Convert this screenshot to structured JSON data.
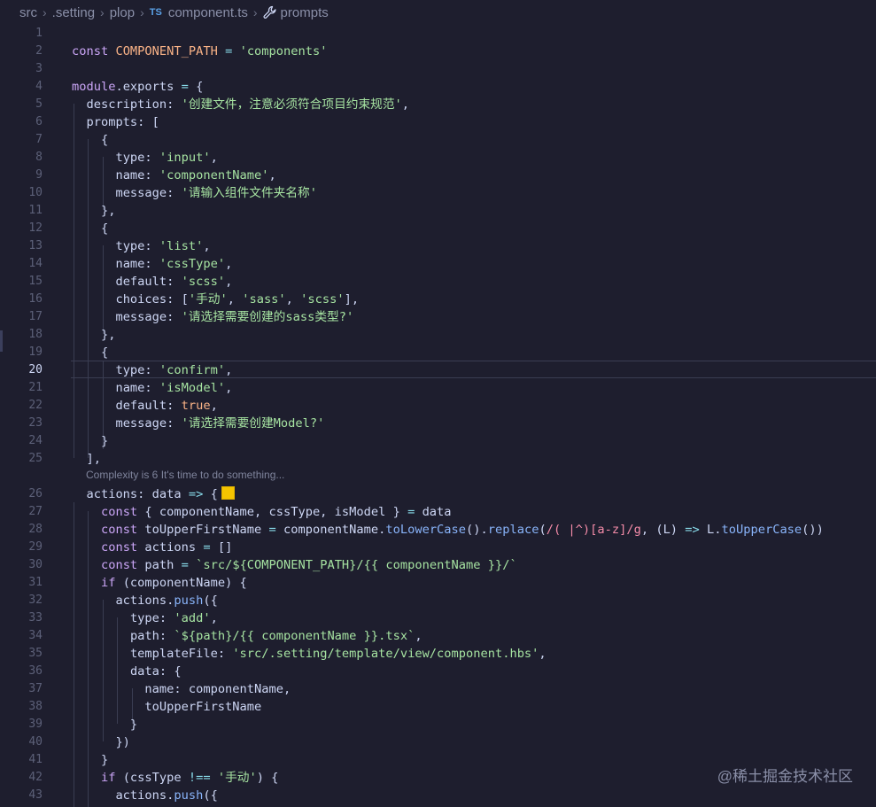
{
  "breadcrumb": {
    "items": [
      "src",
      ".setting",
      "plop",
      "component.ts",
      "prompts"
    ],
    "ts_badge": "TS"
  },
  "codelens": "Complexity is 6 It's time to do something...",
  "watermark": "@稀土掘金技术社区",
  "active_line": 20,
  "colors": {
    "background": "#1e1e2e",
    "keyword": "#cba6f7",
    "string": "#a6e3a1",
    "function": "#89b4fa",
    "swatch": "#f5c400"
  },
  "lines": [
    {
      "n": "1",
      "text": ""
    },
    {
      "n": "2",
      "text": "const COMPONENT_PATH = 'components'"
    },
    {
      "n": "3",
      "text": ""
    },
    {
      "n": "4",
      "text": "module.exports = {"
    },
    {
      "n": "5",
      "text": "  description: '创建文件，注意必须符合项目约束规范',"
    },
    {
      "n": "6",
      "text": "  prompts: ["
    },
    {
      "n": "7",
      "text": "    {"
    },
    {
      "n": "8",
      "text": "      type: 'input',"
    },
    {
      "n": "9",
      "text": "      name: 'componentName',"
    },
    {
      "n": "10",
      "text": "      message: '请输入组件文件夹名称'"
    },
    {
      "n": "11",
      "text": "    },"
    },
    {
      "n": "12",
      "text": "    {"
    },
    {
      "n": "13",
      "text": "      type: 'list',"
    },
    {
      "n": "14",
      "text": "      name: 'cssType',"
    },
    {
      "n": "15",
      "text": "      default: 'scss',"
    },
    {
      "n": "16",
      "text": "      choices: ['手动', 'sass', 'scss'],"
    },
    {
      "n": "17",
      "text": "      message: '请选择需要创建的sass类型?'"
    },
    {
      "n": "18",
      "text": "    },"
    },
    {
      "n": "19",
      "text": "    {"
    },
    {
      "n": "20",
      "text": "      type: 'confirm',"
    },
    {
      "n": "21",
      "text": "      name: 'isModel',"
    },
    {
      "n": "22",
      "text": "      default: true,"
    },
    {
      "n": "23",
      "text": "      message: '请选择需要创建Model?'"
    },
    {
      "n": "24",
      "text": "    }"
    },
    {
      "n": "25",
      "text": "  ],"
    },
    {
      "n": "26",
      "text": "  actions: data => {"
    },
    {
      "n": "27",
      "text": "    const { componentName, cssType, isModel } = data"
    },
    {
      "n": "28",
      "text": "    const toUpperFirstName = componentName.toLowerCase().replace(/( |^)[a-z]/g, (L) => L.toUpperCase())"
    },
    {
      "n": "29",
      "text": "    const actions = []"
    },
    {
      "n": "30",
      "text": "    const path = `src/${COMPONENT_PATH}/{{ componentName }}/`"
    },
    {
      "n": "31",
      "text": "    if (componentName) {"
    },
    {
      "n": "32",
      "text": "      actions.push({"
    },
    {
      "n": "33",
      "text": "        type: 'add',"
    },
    {
      "n": "34",
      "text": "        path: `${path}/{{ componentName }}.tsx`,"
    },
    {
      "n": "35",
      "text": "        templateFile: 'src/.setting/template/view/component.hbs',"
    },
    {
      "n": "36",
      "text": "        data: {"
    },
    {
      "n": "37",
      "text": "          name: componentName,"
    },
    {
      "n": "38",
      "text": "          toUpperFirstName"
    },
    {
      "n": "39",
      "text": "        }"
    },
    {
      "n": "40",
      "text": "      })"
    },
    {
      "n": "41",
      "text": "    }"
    },
    {
      "n": "42",
      "text": "    if (cssType !== '手动') {"
    },
    {
      "n": "43",
      "text": "      actions.push({"
    }
  ]
}
